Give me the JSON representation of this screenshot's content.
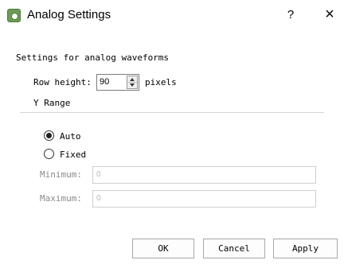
{
  "window": {
    "title": "Analog Settings",
    "help_label": "?",
    "close_label": "×"
  },
  "section_label": "Settings for analog waveforms",
  "row_height": {
    "label": "Row height:",
    "value": "90",
    "unit": "pixels"
  },
  "y_range": {
    "group_label": "Y Range",
    "options": [
      {
        "label": "Auto",
        "selected": true
      },
      {
        "label": "Fixed",
        "selected": false
      }
    ],
    "minimum": {
      "label": "Minimum:",
      "value": "0"
    },
    "maximum": {
      "label": "Maximum:",
      "value": "0"
    }
  },
  "buttons": {
    "ok": "OK",
    "cancel": "Cancel",
    "apply": "Apply"
  }
}
